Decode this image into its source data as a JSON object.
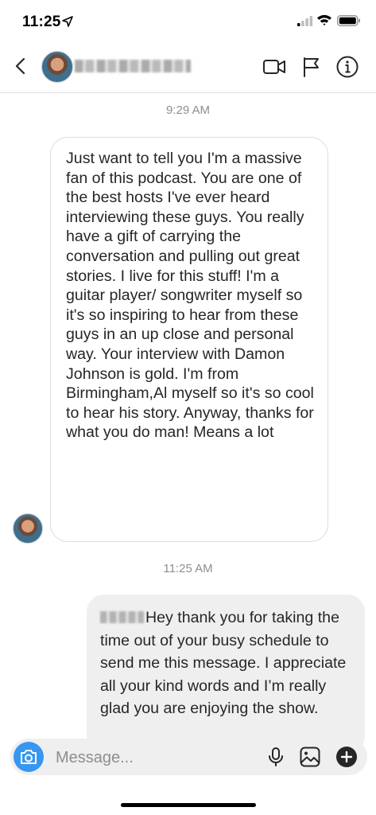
{
  "status_bar": {
    "time": "11:25"
  },
  "conversation": {
    "time_1": "9:29 AM",
    "incoming_message": "Just want to tell you I'm a massive fan of this podcast. You are one of the best hosts I've ever heard interviewing these guys. You really have a gift of carrying the conversation and pulling out great stories. I live for this stuff! I'm a guitar player/ songwriter myself so it's so inspiring to hear from these guys in an up close and personal way. Your interview with Damon Johnson is gold. I'm from Birmingham,Al myself so it's so cool to hear his story. Anyway, thanks for what you do man! Means a lot",
    "time_2": "11:25 AM",
    "outgoing_message": "Hey thank you for taking the time out of your busy schedule to send me this message. I appreciate all your kind words and I’m really glad you are enjoying the show."
  },
  "composer": {
    "placeholder": "Message..."
  },
  "colors": {
    "accent": "#3797f0",
    "bubble_out": "#efefef",
    "bubble_border": "#dbdbdb",
    "timestamp": "#8e8e8e"
  },
  "icons": [
    "location-arrow-icon",
    "signal-icon",
    "wifi-icon",
    "battery-icon",
    "back-arrow-icon",
    "video-call-icon",
    "flag-icon",
    "info-icon",
    "camera-icon",
    "microphone-icon",
    "gallery-icon",
    "plus-icon"
  ]
}
